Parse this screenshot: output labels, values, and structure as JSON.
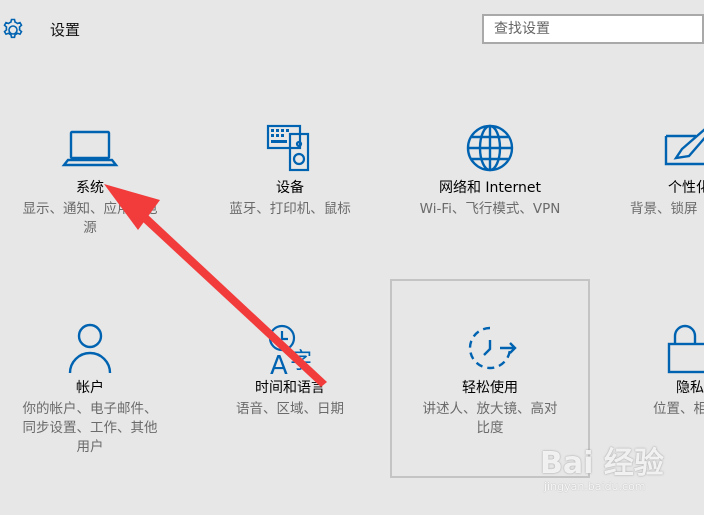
{
  "header": {
    "title": "设置",
    "settings_icon": "gear-icon"
  },
  "search": {
    "placeholder": "查找设置",
    "value": ""
  },
  "accent_color": "#0063b1",
  "tiles": [
    {
      "name": "系统",
      "desc_lines": [
        "显示、通知、应用、电",
        "源"
      ],
      "icon": "laptop-icon"
    },
    {
      "name": "设备",
      "desc_lines": [
        "蓝牙、打印机、鼠标"
      ],
      "icon": "keyboard-speaker-icon"
    },
    {
      "name": "网络和 Internet",
      "desc_lines": [
        "Wi-Fi、飞行模式、VPN"
      ],
      "icon": "globe-icon"
    },
    {
      "name": "个性化",
      "desc_lines": [
        "背景、锁屏"
      ],
      "icon": "paint-brush-icon"
    },
    {
      "name": "帐户",
      "desc_lines": [
        "你的帐户、电子邮件、",
        "同步设置、工作、其他",
        "用户"
      ],
      "icon": "person-icon"
    },
    {
      "name": "时间和语言",
      "desc_lines": [
        "语音、区域、日期"
      ],
      "icon": "clock-language-icon"
    },
    {
      "name": "轻松使用",
      "desc_lines": [
        "讲述人、放大镜、高对",
        "比度"
      ],
      "icon": "ease-of-access-icon"
    },
    {
      "name": "隐私",
      "desc_lines": [
        "位置、相"
      ],
      "icon": "lock-icon"
    }
  ],
  "annotation": {
    "arrow_color": "#f23c3c"
  },
  "watermark": {
    "main": "Bai 经验",
    "sub": "jingyan.baidu.com"
  }
}
